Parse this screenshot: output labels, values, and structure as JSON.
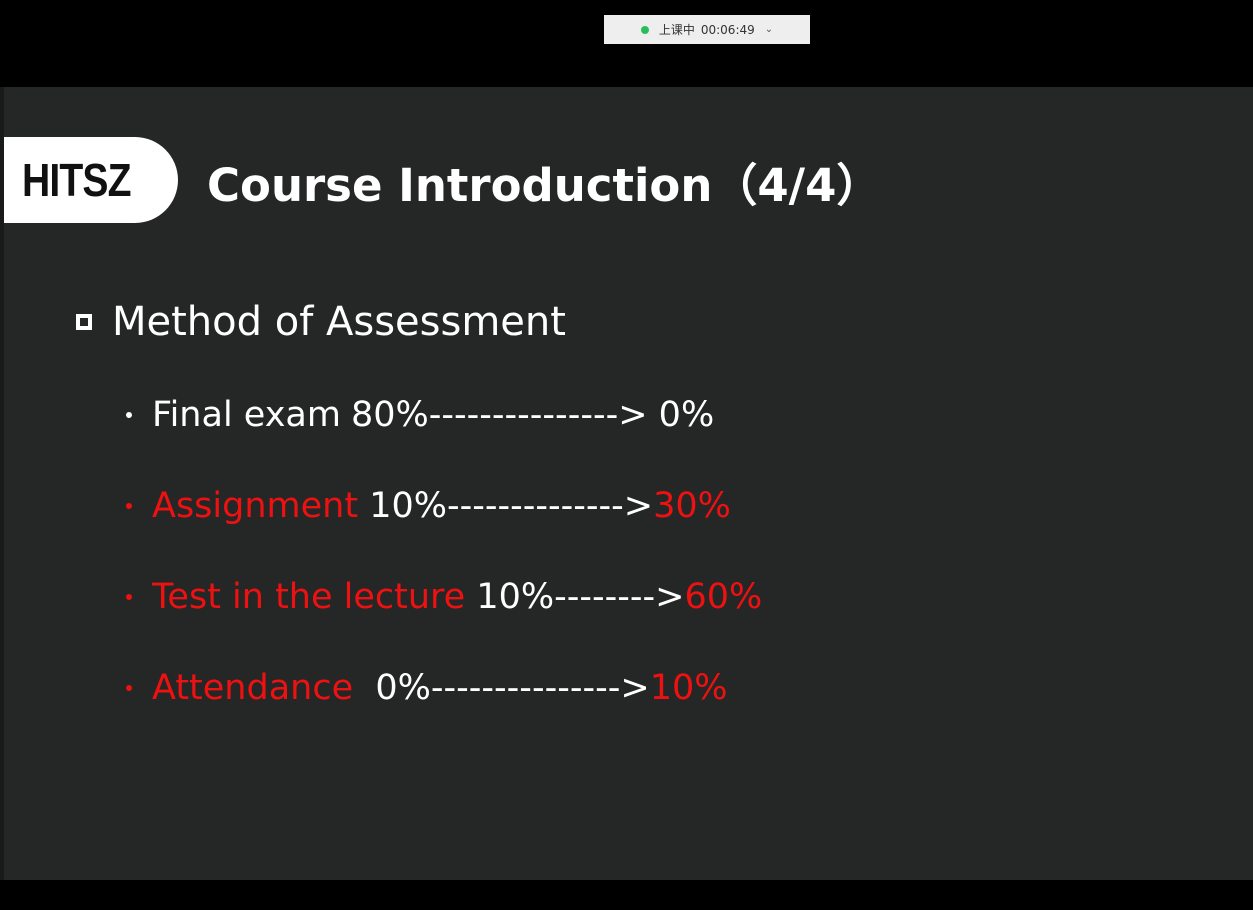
{
  "status_bar": {
    "label": "上课中",
    "timer": "00:06:49",
    "indicator_color": "#2bbd5a",
    "dropdown_icon": "chevron-down-icon"
  },
  "slide": {
    "logo": "HITSZ",
    "title": "Course Introduction（4/4）",
    "section": "Method of Assessment",
    "items": [
      {
        "name": "Final exam",
        "from": "80%",
        "arrow": "--------------->",
        "to": " 0%"
      },
      {
        "name": "Assignment",
        "from": " 10%",
        "arrow": "-------------->",
        "to": "30%"
      },
      {
        "name": "Test in the lecture",
        "from": " 10%",
        "arrow": "-------->",
        "to": "60%"
      },
      {
        "name": "Attendance",
        "from": "  0%",
        "arrow": "--------------->",
        "to": "10%"
      }
    ],
    "colors": {
      "background": "#252626",
      "text": "#ffffff",
      "highlight": "#ee1111"
    }
  }
}
